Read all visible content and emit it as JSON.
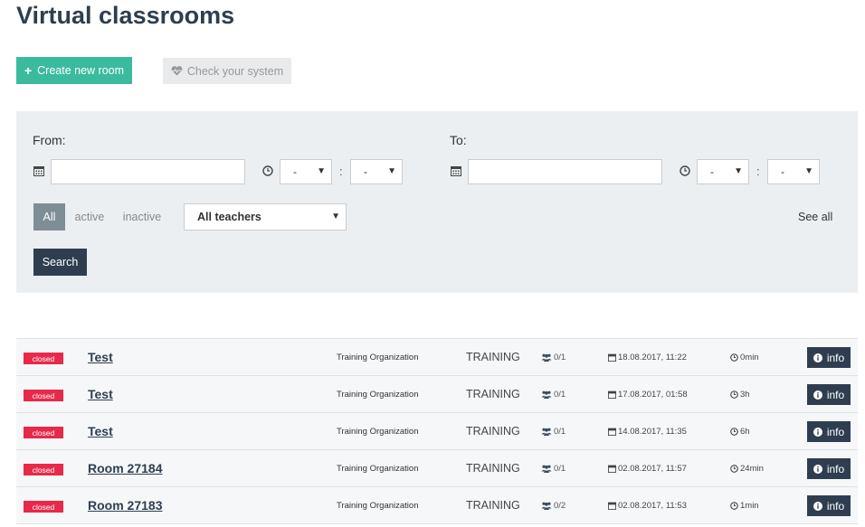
{
  "page": {
    "title": "Virtual classrooms"
  },
  "toolbar": {
    "create_label": "Create new room",
    "check_label": "Check your system"
  },
  "filters": {
    "from_label": "From:",
    "to_label": "To:",
    "from_hour": "-",
    "from_minute": "-",
    "to_hour": "-",
    "to_minute": "-",
    "time_separator": ":",
    "status": {
      "all": "All",
      "active": "active",
      "inactive": "inactive"
    },
    "teacher_select": "All teachers",
    "see_all": "See all",
    "search_label": "Search"
  },
  "colors": {
    "accent": "#3bbb9e",
    "primary": "#2e3e50",
    "closed": "#e8294a",
    "panel": "#eceff1"
  },
  "rooms": [
    {
      "status": "closed",
      "name": "Test",
      "organization": "Training Organization",
      "type": "TRAINING",
      "participants": "0/1",
      "date": "18.08.2017, 11:22",
      "duration": "0min",
      "info_label": "info"
    },
    {
      "status": "closed",
      "name": "Test",
      "organization": "Training Organization",
      "type": "TRAINING",
      "participants": "0/1",
      "date": "17.08.2017, 01:58",
      "duration": "3h",
      "info_label": "info"
    },
    {
      "status": "closed",
      "name": "Test",
      "organization": "Training Organization",
      "type": "TRAINING",
      "participants": "0/1",
      "date": "14.08.2017, 11:35",
      "duration": "6h",
      "info_label": "info"
    },
    {
      "status": "closed",
      "name": "Room 27184",
      "organization": "Training Organization",
      "type": "TRAINING",
      "participants": "0/1",
      "date": "02.08.2017, 11:57",
      "duration": "24min",
      "info_label": "info"
    },
    {
      "status": "closed",
      "name": "Room 27183",
      "organization": "Training Organization",
      "type": "TRAINING",
      "participants": "0/2",
      "date": "02.08.2017, 11:53",
      "duration": "1min",
      "info_label": "info"
    }
  ]
}
